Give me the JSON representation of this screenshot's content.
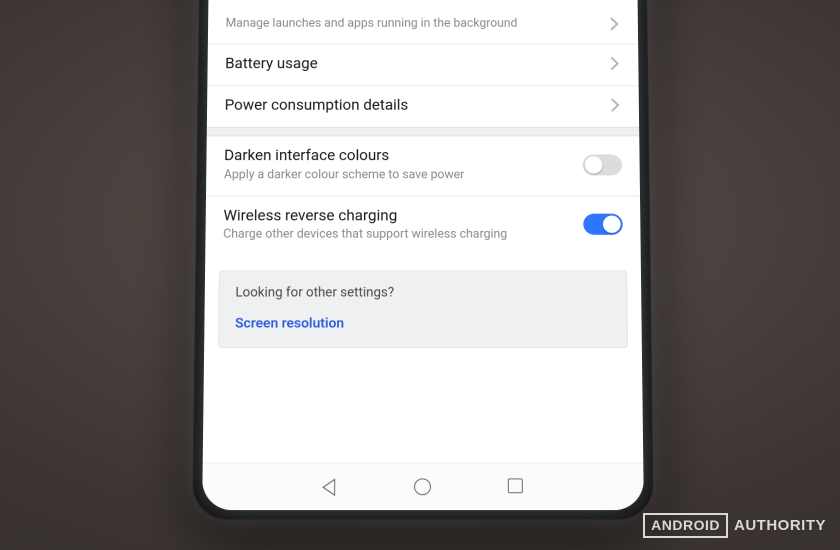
{
  "settings": {
    "launch_row": {
      "subtitle": "Manage launches and apps running in the background"
    },
    "battery_usage": {
      "title": "Battery usage"
    },
    "power_details": {
      "title": "Power consumption details"
    },
    "darken": {
      "title": "Darken interface colours",
      "subtitle": "Apply a darker colour scheme to save power",
      "enabled": false
    },
    "wireless_reverse": {
      "title": "Wireless reverse charging",
      "subtitle": "Charge other devices that support wireless charging",
      "enabled": true
    },
    "tip": {
      "question": "Looking for other settings?",
      "link": "Screen resolution"
    }
  },
  "watermark": {
    "box": "ANDROID",
    "text": "AUTHORITY"
  }
}
